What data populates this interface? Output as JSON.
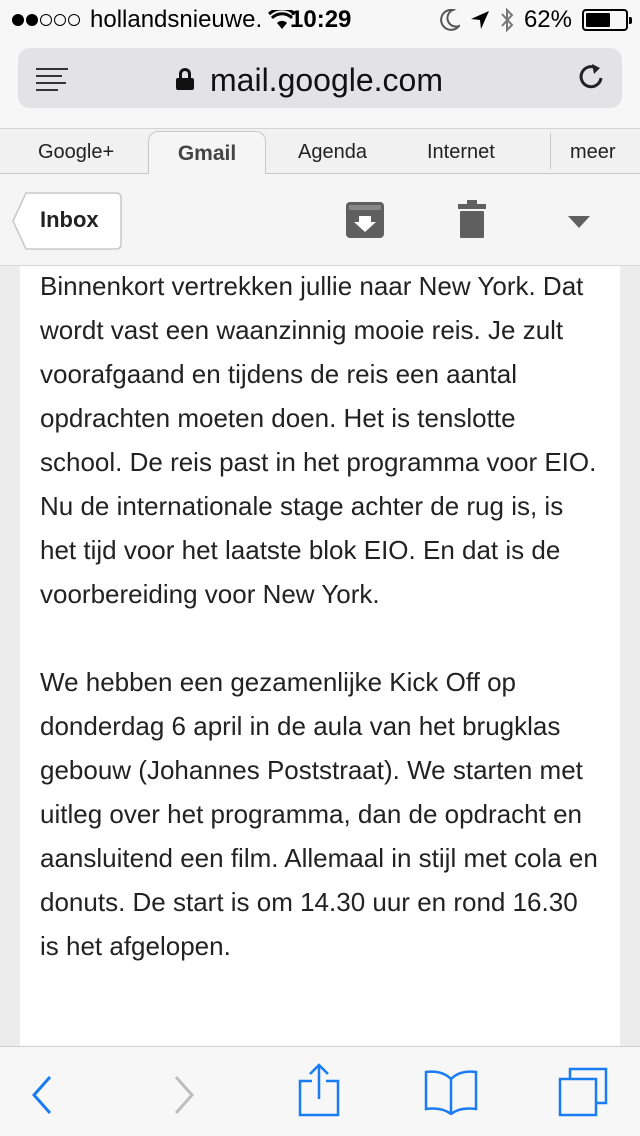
{
  "status_bar": {
    "carrier": "hollandsnieuwe.",
    "time": "10:29",
    "battery": "62%",
    "signal_dots_filled": 2,
    "signal_dots_total": 5,
    "battery_level": 0.62
  },
  "url_bar": {
    "url": "mail.google.com"
  },
  "google_nav": {
    "tabs": [
      "Google+",
      "Gmail",
      "Agenda",
      "Internet",
      "meer"
    ],
    "active": "Gmail"
  },
  "action_bar": {
    "back_label": "Inbox"
  },
  "message": {
    "paragraphs": [
      "Binnenkort vertrekken jullie naar New York. Dat wordt vast een waanzinnig mooie reis. Je zult voorafgaand en tijdens de reis een aantal opdrachten moeten doen. Het is tenslotte school. De reis past in het programma voor EIO. Nu de internationale stage achter de rug is, is het tijd voor het laatste blok EIO. En dat is de voorbereiding voor New York.",
      "We hebben een gezamenlijke Kick Off op donderdag 6 april in de aula van het brugklas gebouw (Johannes Poststraat). We starten met uitleg over het programma, dan de opdracht en aansluitend een film. Allemaal in stijl met cola en donuts. De start is om 14.30 uur en rond 16.30 is het afgelopen."
    ]
  },
  "colors": {
    "accent_blue": "#1a7cf2",
    "icon_gray": "#5f5f5f",
    "text": "#222222"
  }
}
